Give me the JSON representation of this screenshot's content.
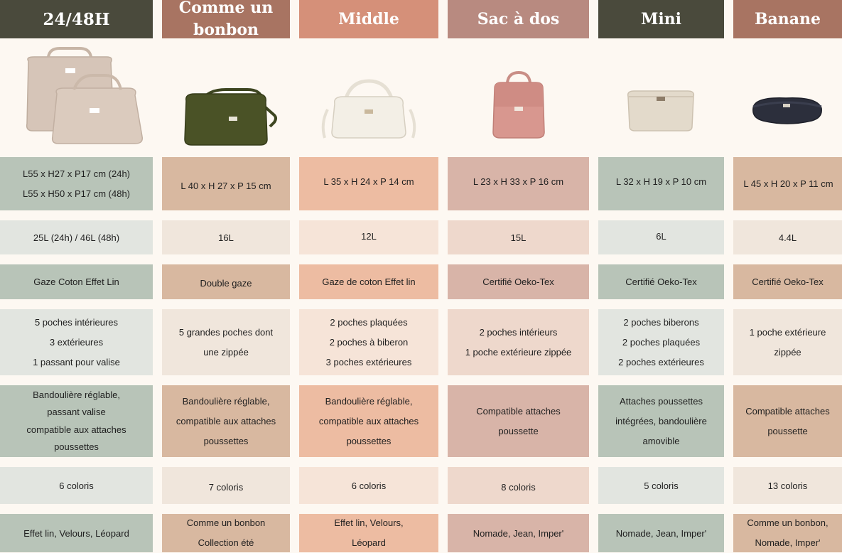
{
  "colors": {
    "page_bg": "#fdf8f2",
    "dark_header": "#4a4a3c",
    "terracotta_header": "#a87462",
    "salmon_header": "#d59079",
    "rose_header": "#b88a80",
    "sage_dark": "#b8c4b8",
    "sage_light": "#e2e5e0",
    "tan_dark": "#d8b8a0",
    "tan_light": "#f0e6dc",
    "peach_dark": "#edbca2",
    "peach_light": "#f6e4d8",
    "pink_dark": "#d8b4a8",
    "pink_light": "#eed8cc"
  },
  "columns": [
    {
      "key": "c1",
      "header": "24/48H",
      "image_icon": "large-diaper-bag-set-icon",
      "dimensions": [
        "L55 x H27 x P17 cm (24h)",
        "L55 x H50 x P17 cm (48h)"
      ],
      "capacity": [
        "25L (24h) / 46L (48h)"
      ],
      "material": [
        "Gaze Coton Effet Lin"
      ],
      "pockets": [
        "5 poches intérieures",
        "3 extérieures",
        "1 passant pour valise"
      ],
      "features": [
        "Bandoulière réglable,",
        "passant valise",
        "compatible aux attaches",
        "poussettes"
      ],
      "colors_count": [
        "6 coloris"
      ],
      "collections": [
        "Effet lin, Velours, Léopard"
      ]
    },
    {
      "key": "c2",
      "header": "Comme un bonbon",
      "image_icon": "olive-diaper-bag-icon",
      "dimensions": [
        "L 40 x H 27 x P 15 cm"
      ],
      "capacity": [
        "16L"
      ],
      "material": [
        "Double gaze"
      ],
      "pockets": [
        "5 grandes poches dont",
        "une zippée"
      ],
      "features": [
        "Bandoulière réglable,",
        "compatible aux attaches",
        "poussettes"
      ],
      "colors_count": [
        "7 coloris"
      ],
      "collections": [
        "Comme un bonbon",
        "Collection été"
      ]
    },
    {
      "key": "c3",
      "header": "Middle",
      "image_icon": "white-shoulder-bag-icon",
      "dimensions": [
        "L 35 x H 24 x P 14 cm"
      ],
      "capacity": [
        "12L"
      ],
      "material": [
        "Gaze de coton Effet lin"
      ],
      "pockets": [
        "2 poches plaquées",
        "2 poches à biberon",
        "3 poches extérieures"
      ],
      "features": [
        "Bandoulière réglable,",
        "compatible aux attaches",
        "poussettes"
      ],
      "colors_count": [
        "6 coloris"
      ],
      "collections": [
        "Effet lin, Velours,",
        "Léopard"
      ]
    },
    {
      "key": "c4",
      "header": "Sac à dos",
      "image_icon": "pink-backpack-icon",
      "dimensions": [
        "L 23 x H 33 x P 16 cm"
      ],
      "capacity": [
        "15L"
      ],
      "material": [
        "Certifié Oeko-Tex"
      ],
      "pockets": [
        "2 poches intérieurs",
        "1 poche extérieure zippée"
      ],
      "features": [
        "Compatible attaches",
        "poussette"
      ],
      "colors_count": [
        "8 coloris"
      ],
      "collections": [
        "Nomade, Jean, Imper'"
      ]
    },
    {
      "key": "c5",
      "header": "Mini",
      "image_icon": "beige-mini-bag-icon",
      "dimensions": [
        "L 32 x H 19 x P 10 cm"
      ],
      "capacity": [
        "6L"
      ],
      "material": [
        "Certifié Oeko-Tex"
      ],
      "pockets": [
        "2 poches biberons",
        "2 poches plaquées",
        "2 poches extérieures"
      ],
      "features": [
        "Attaches poussettes",
        "intégrées, bandoulière",
        "amovible"
      ],
      "colors_count": [
        "5 coloris"
      ],
      "collections": [
        "Nomade, Jean, Imper'"
      ]
    },
    {
      "key": "c6",
      "header": "Banane",
      "image_icon": "navy-belt-bag-icon",
      "dimensions": [
        "L 45 x H 20 x P 11 cm"
      ],
      "capacity": [
        "4.4L"
      ],
      "material": [
        "Certifié Oeko-Tex"
      ],
      "pockets": [
        "1 poche extérieure",
        "zippée"
      ],
      "features": [
        "Compatible attaches",
        "poussette"
      ],
      "colors_count": [
        "13 coloris"
      ],
      "collections": [
        "Comme un bonbon,",
        "Nomade, Imper'"
      ]
    }
  ]
}
